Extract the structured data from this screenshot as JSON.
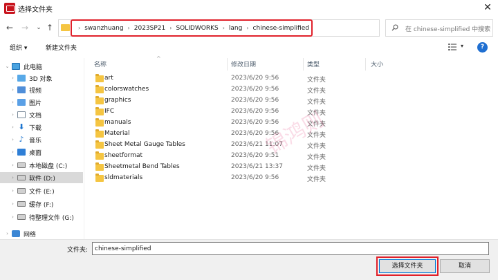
{
  "window": {
    "title": "选择文件夹",
    "close": "✕"
  },
  "nav": {
    "back": "←",
    "forward": "→",
    "recent": "⌄",
    "up": "↑",
    "sep": "›",
    "dropdown": "⌄",
    "refresh": "↻",
    "breadcrumbs": [
      "swanzhuang",
      "2023SP21",
      "SOLIDWORKS",
      "lang",
      "chinese-simplified"
    ]
  },
  "search": {
    "placeholder": "在 chinese-simplified 中搜索"
  },
  "toolbar": {
    "organize": "组织 ▾",
    "new_folder": "新建文件夹",
    "view_dd": "▾",
    "help": "?"
  },
  "columns": {
    "name": "名称",
    "date": "修改日期",
    "type": "类型",
    "size": "大小",
    "sort": "^"
  },
  "sidebar": {
    "items": [
      {
        "label": "此电脑",
        "icon": "pc-icon",
        "expander": "⌄"
      },
      {
        "label": "3D 对象",
        "icon": "3d-objects-icon",
        "expander": "›"
      },
      {
        "label": "视频",
        "icon": "video-icon",
        "expander": "›"
      },
      {
        "label": "图片",
        "icon": "pictures-icon",
        "expander": "›"
      },
      {
        "label": "文档",
        "icon": "documents-icon",
        "expander": "›"
      },
      {
        "label": "下载",
        "icon": "downloads-icon",
        "expander": "›"
      },
      {
        "label": "音乐",
        "icon": "music-icon",
        "expander": "›"
      },
      {
        "label": "桌面",
        "icon": "desktop-icon",
        "expander": "›"
      },
      {
        "label": "本地磁盘 (C:)",
        "icon": "drive-icon",
        "expander": "›"
      },
      {
        "label": "软件 (D:)",
        "icon": "drive-icon",
        "expander": "›"
      },
      {
        "label": "文件 (E:)",
        "icon": "drive-icon",
        "expander": "›"
      },
      {
        "label": "缓存 (F:)",
        "icon": "drive-icon",
        "expander": "›"
      },
      {
        "label": "待整理文件 (G:)",
        "icon": "drive-icon",
        "expander": "›"
      },
      {
        "label": "网络",
        "icon": "network-icon",
        "expander": "›"
      }
    ]
  },
  "files": [
    {
      "name": "art",
      "date": "2023/6/20 9:56",
      "type": "文件夹"
    },
    {
      "name": "colorswatches",
      "date": "2023/6/20 9:56",
      "type": "文件夹"
    },
    {
      "name": "graphics",
      "date": "2023/6/20 9:56",
      "type": "文件夹"
    },
    {
      "name": "IFC",
      "date": "2023/6/20 9:56",
      "type": "文件夹"
    },
    {
      "name": "manuals",
      "date": "2023/6/20 9:56",
      "type": "文件夹"
    },
    {
      "name": "Material",
      "date": "2023/6/20 9:56",
      "type": "文件夹"
    },
    {
      "name": "Sheet Metal Gauge Tables",
      "date": "2023/6/21 11:07",
      "type": "文件夹"
    },
    {
      "name": "sheetformat",
      "date": "2023/6/20 9:51",
      "type": "文件夹"
    },
    {
      "name": "Sheetmetal Bend Tables",
      "date": "2023/6/21 13:37",
      "type": "文件夹"
    },
    {
      "name": "sldmaterials",
      "date": "2023/6/20 9:56",
      "type": "文件夹"
    }
  ],
  "watermark": "锦鸿则",
  "bottom": {
    "folder_label": "文件夹:",
    "folder_value": "chinese-simplified",
    "select_label": "选择文件夹",
    "cancel_label": "取消"
  },
  "colors": {
    "highlight": "#e0202a",
    "folder": "#f5c542",
    "selected": "#d9d9d9"
  }
}
